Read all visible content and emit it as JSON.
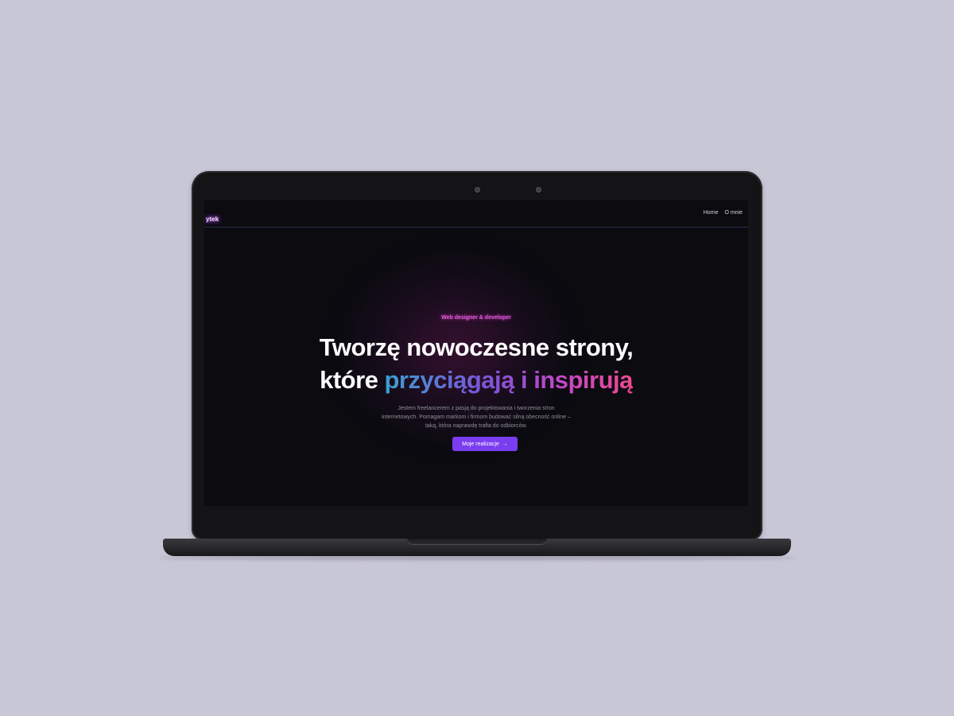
{
  "site": {
    "logo": "ytek",
    "nav": [
      "Home",
      "O mnie"
    ]
  },
  "hero": {
    "eyebrow": "Web designer & developer",
    "headline_line1": "Tworzę nowoczesne strony,",
    "headline_line2_plain": "które ",
    "headline_line2_gradient": "przyciągają i inspirują",
    "subtitle": "Jestem freelancerem z pasją do projektowania i tworzenia stron internetowych. Pomagam markom i firmom budować silną obecność online – taką, która naprawdę trafia do odbiorców.",
    "cta_label": "Moje realizacje",
    "cta_arrow": "→"
  },
  "colors": {
    "accent": "#7a3df0",
    "gradient_start": "#3aa0d0",
    "gradient_end": "#f04890",
    "background": "#c8c7d6",
    "screen_bg": "#0b0b10"
  }
}
